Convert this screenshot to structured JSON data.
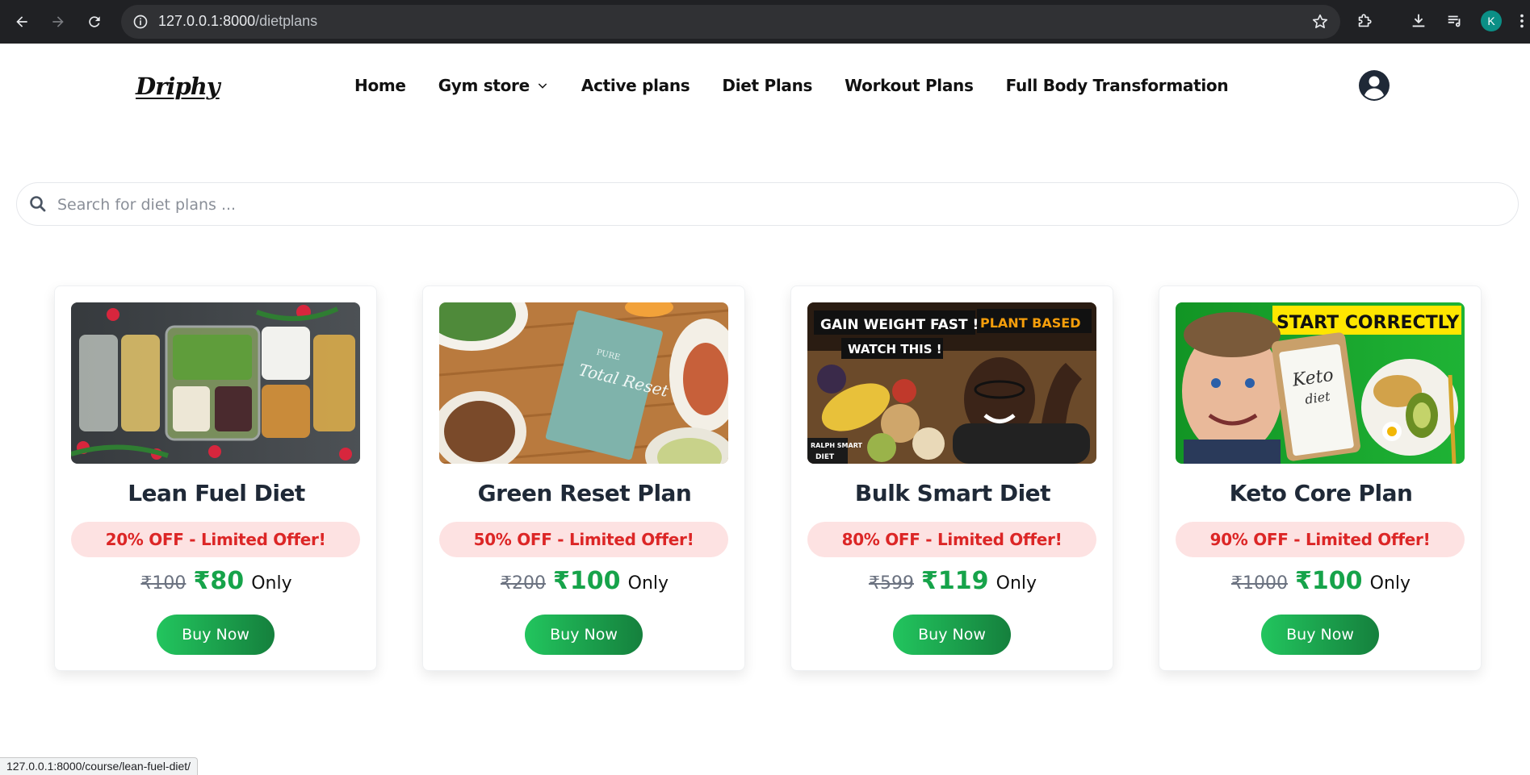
{
  "browser": {
    "url_host": "127.0.0.1:8000",
    "url_path": "/dietplans",
    "profile_initial": "K",
    "status_url": "127.0.0.1:8000/course/lean-fuel-diet/"
  },
  "site": {
    "logo": "Driphy",
    "nav": [
      {
        "label": "Home"
      },
      {
        "label": "Gym store",
        "icon": "chevron-down-icon"
      },
      {
        "label": "Active plans"
      },
      {
        "label": "Diet Plans"
      },
      {
        "label": "Workout Plans"
      },
      {
        "label": "Full Body Transformation"
      }
    ],
    "account_icon": "user-circle-icon"
  },
  "search": {
    "placeholder": "Search for diet plans ...",
    "value": ""
  },
  "cards": [
    {
      "title": "Lean Fuel Diet",
      "offer": "20% OFF - Limited Offer!",
      "old_price": "₹100",
      "new_price": "₹80",
      "suffix": "Only",
      "button": "Buy Now",
      "image_text": []
    },
    {
      "title": "Green Reset Plan",
      "offer": "50% OFF - Limited Offer!",
      "old_price": "₹200",
      "new_price": "₹100",
      "suffix": "Only",
      "button": "Buy Now",
      "image_text": [
        "Total Reset",
        "PURE"
      ]
    },
    {
      "title": "Bulk Smart Diet",
      "offer": "80% OFF - Limited Offer!",
      "old_price": "₹599",
      "new_price": "₹119",
      "suffix": "Only",
      "button": "Buy Now",
      "image_text": [
        "GAIN WEIGHT FAST !",
        "PLANT BASED",
        "WATCH THIS !",
        "RALPH SMART",
        "DIET"
      ]
    },
    {
      "title": "Keto Core Plan",
      "offer": "90% OFF - Limited Offer!",
      "old_price": "₹1000",
      "new_price": "₹100",
      "suffix": "Only",
      "button": "Buy Now",
      "image_text": [
        "START CORRECTLY",
        "Keto",
        "diet"
      ]
    }
  ],
  "colors": {
    "offer_text": "#dc2626",
    "offer_bg": "#fde2e2",
    "price_green": "#16a34a",
    "button_start": "#22c55e",
    "button_end": "#15803d"
  }
}
